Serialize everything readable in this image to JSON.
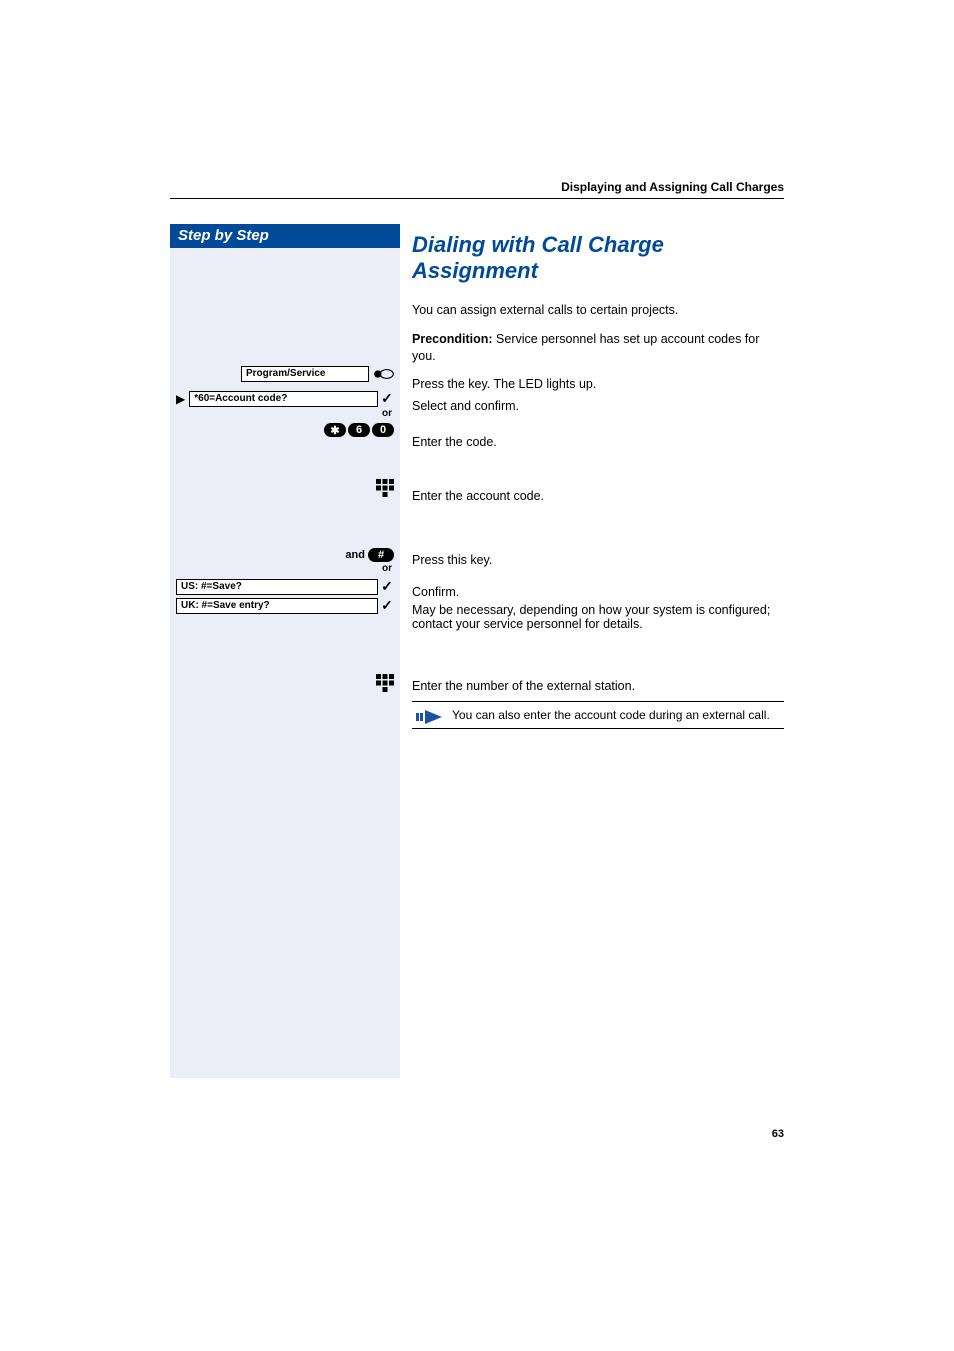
{
  "header": {
    "running_title": "Displaying and Assigning Call Charges"
  },
  "sidebar": {
    "title": "Step by Step",
    "program_service": "Program/Service",
    "account_code_prompt": "*60=Account code?",
    "or": "or",
    "keys": {
      "star": "✱",
      "six": "6",
      "zero": "0"
    },
    "and": "and",
    "hash_key": "#",
    "us_save": "US: #=Save?",
    "uk_save": "UK: #=Save entry?"
  },
  "content": {
    "title": "Dialing with Call Charge Assignment",
    "intro": "You can assign external calls to certain projects.",
    "precondition_label": "Precondition:",
    "precondition_text": " Service personnel has set up account codes for you.",
    "press_led": "Press the key. The LED lights up.",
    "select_confirm": "Select and confirm.",
    "enter_code": "Enter the code.",
    "enter_account_code": "Enter the account code.",
    "press_this_key": "Press this key.",
    "confirm": "Confirm.",
    "may_be_necessary": "May be necessary, depending on how your system is configured; contact your service personnel for details.",
    "enter_external": "Enter the number of the external station.",
    "note": "You can also enter the account code during an external call."
  },
  "page_number": "63"
}
